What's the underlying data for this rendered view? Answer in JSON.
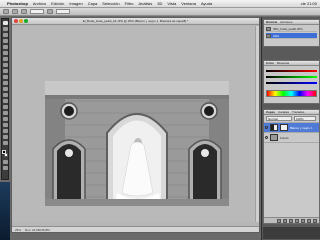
{
  "menubar": {
    "apple": "",
    "items": [
      "Photoshop",
      "Archivo",
      "Edición",
      "Imagen",
      "Capa",
      "Selección",
      "Filtro",
      "Análisis",
      "3D",
      "Vista",
      "Ventana",
      "Ayuda"
    ],
    "clock": "vie 21:00"
  },
  "document": {
    "title": "El_Boda_boda_peddi_04.JPG @ 25% (Blanco y negro 1, Máscara de capa/8) *"
  },
  "statusbar": {
    "zoom": "25%",
    "info": "Doc: 22,9M/45,8M"
  },
  "panels": {
    "history_tabs": [
      "Historia",
      "Acciones"
    ],
    "history_items": [
      "IMG_boda_peddi.JPG",
      "Abrir"
    ],
    "color_tabs": [
      "Color",
      "Muestras"
    ],
    "layers_tabs": [
      "Capas",
      "Canales",
      "Trazados"
    ],
    "blend_mode": "Normal",
    "opacity": "100%",
    "layers": [
      {
        "name": "Blanco y negro 1",
        "kind": "adjustment",
        "selected": true
      },
      {
        "name": "Fondo",
        "kind": "image",
        "selected": false
      }
    ]
  },
  "colors": {
    "accent": "#3d6fd6",
    "panel_bg": "#c9c9c9",
    "menubar_bg": "#e6e6e6"
  }
}
